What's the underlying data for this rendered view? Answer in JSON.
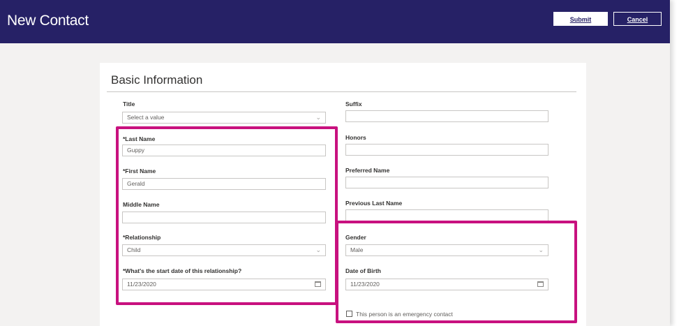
{
  "header": {
    "title": "New Contact",
    "submit_label": "Submit",
    "cancel_label": "Cancel",
    "bg_color": "#262166"
  },
  "section": {
    "title": "Basic Information"
  },
  "fields": {
    "title": {
      "label": "Title",
      "placeholder": "Select a value"
    },
    "suffix": {
      "label": "Suffix",
      "value": ""
    },
    "last_name": {
      "label": "*Last Name",
      "value": "Guppy"
    },
    "honors": {
      "label": "Honors",
      "value": ""
    },
    "first_name": {
      "label": "*First Name",
      "value": "Gerald"
    },
    "preferred_name": {
      "label": "Preferred Name",
      "value": ""
    },
    "middle_name": {
      "label": "Middle Name",
      "value": ""
    },
    "previous_last_name": {
      "label": "Previous Last Name",
      "value": ""
    },
    "relationship": {
      "label": "*Relationship",
      "value": "Child"
    },
    "gender": {
      "label": "Gender",
      "value": "Male"
    },
    "relationship_start": {
      "label": "*What's the start date of this relationship?",
      "value": "11/23/2020"
    },
    "date_of_birth": {
      "label": "Date of Birth",
      "value": "11/23/2020"
    },
    "emergency_contact": {
      "label": "This person is an emergency contact",
      "checked": false
    }
  },
  "icons": {
    "dropdown": "chevron-down-icon",
    "date": "calendar-icon"
  },
  "colors": {
    "highlight": "#c8117f"
  }
}
